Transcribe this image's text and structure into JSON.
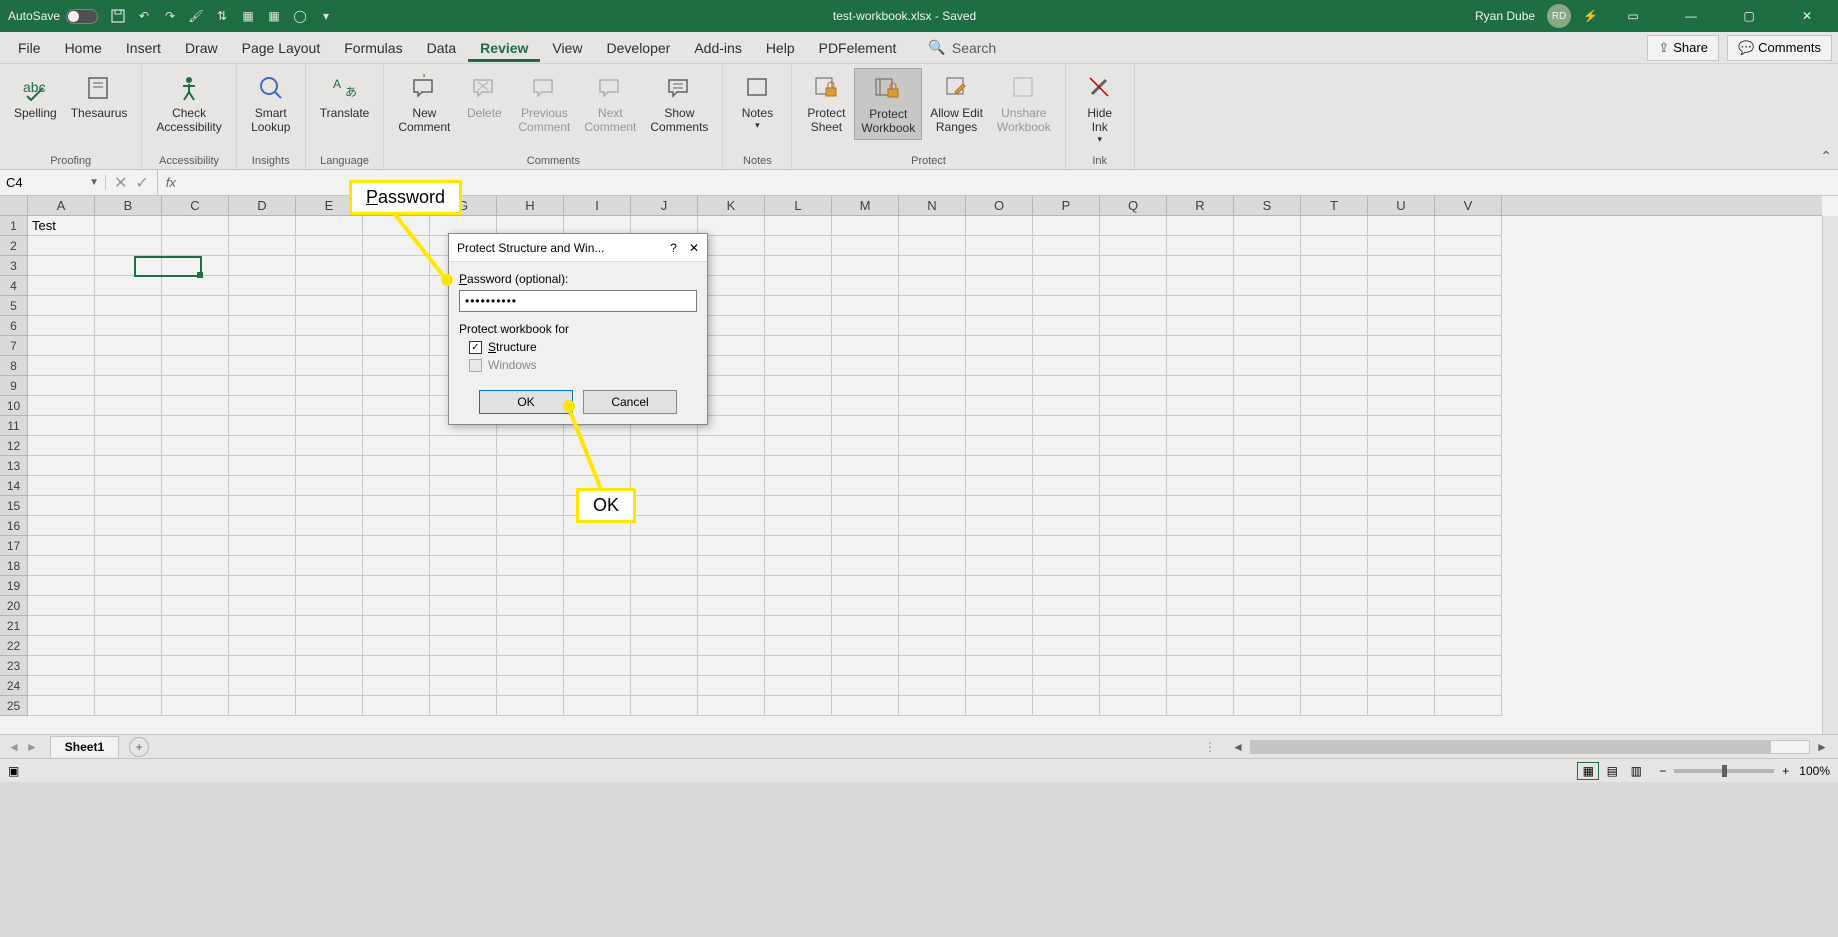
{
  "titlebar": {
    "autosave": "AutoSave",
    "title": "test-workbook.xlsx - Saved",
    "user": "Ryan Dube",
    "user_initials": "RD"
  },
  "menu": {
    "file": "File",
    "home": "Home",
    "insert": "Insert",
    "draw": "Draw",
    "page_layout": "Page Layout",
    "formulas": "Formulas",
    "data": "Data",
    "review": "Review",
    "view": "View",
    "developer": "Developer",
    "addins": "Add-ins",
    "help": "Help",
    "pdf": "PDFelement",
    "search": "Search",
    "share": "Share",
    "comments": "Comments"
  },
  "ribbon": {
    "proofing": {
      "spelling": "Spelling",
      "thesaurus": "Thesaurus",
      "label": "Proofing"
    },
    "accessibility": {
      "check": "Check\nAccessibility",
      "label": "Accessibility"
    },
    "insights": {
      "smart_lookup": "Smart\nLookup",
      "label": "Insights"
    },
    "language": {
      "translate": "Translate",
      "label": "Language"
    },
    "comments": {
      "new": "New\nComment",
      "delete": "Delete",
      "previous": "Previous\nComment",
      "next": "Next\nComment",
      "show": "Show\nComments",
      "label": "Comments"
    },
    "notes": {
      "notes": "Notes",
      "label": "Notes"
    },
    "protect": {
      "protect_sheet": "Protect\nSheet",
      "protect_workbook": "Protect\nWorkbook",
      "allow_edit": "Allow Edit\nRanges",
      "unshare": "Unshare\nWorkbook",
      "label": "Protect"
    },
    "ink": {
      "hide_ink": "Hide\nInk",
      "label": "Ink"
    }
  },
  "formula": {
    "namebox": "C4"
  },
  "grid": {
    "columns": [
      "A",
      "B",
      "C",
      "D",
      "E",
      "F",
      "G",
      "H",
      "I",
      "J",
      "K",
      "L",
      "M",
      "N",
      "O",
      "P",
      "Q",
      "R",
      "S",
      "T",
      "U",
      "V"
    ],
    "rows": [
      "1",
      "2",
      "3",
      "4",
      "5",
      "6",
      "7",
      "8",
      "9",
      "10",
      "11",
      "12",
      "13",
      "14",
      "15",
      "16",
      "17",
      "18",
      "19",
      "20",
      "21",
      "22",
      "23",
      "24",
      "25"
    ],
    "a1": "Test"
  },
  "sheet": {
    "name": "Sheet1"
  },
  "dialog": {
    "title": "Protect Structure and Win...",
    "password_label": "Password (optional):",
    "password_value": "••••••••••",
    "section": "Protect workbook for",
    "structure": "Structure",
    "windows": "Windows",
    "ok": "OK",
    "cancel": "Cancel"
  },
  "callout": {
    "password": "Password",
    "ok": "OK"
  },
  "status": {
    "zoom": "100%"
  }
}
